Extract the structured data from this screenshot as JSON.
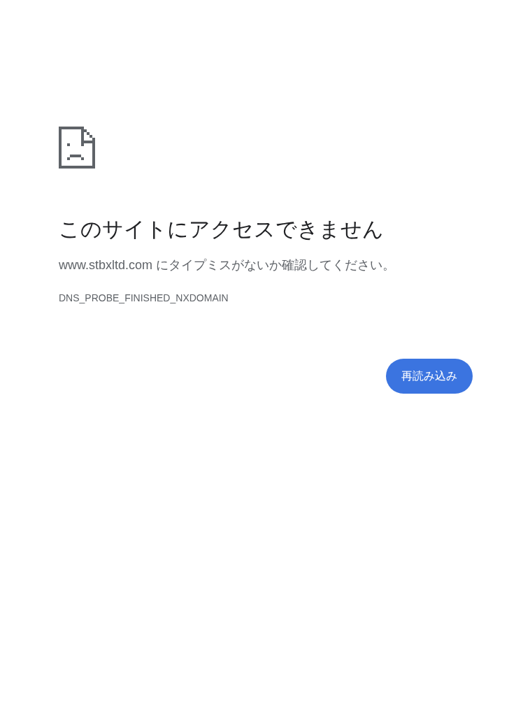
{
  "error": {
    "title": "このサイトにアクセスできません",
    "message": "www.stbxltd.com にタイプミスがないか確認してください。",
    "code": "DNS_PROBE_FINISHED_NXDOMAIN"
  },
  "buttons": [
    {
      "label": "再読み込み",
      "kind": "primary"
    }
  ]
}
